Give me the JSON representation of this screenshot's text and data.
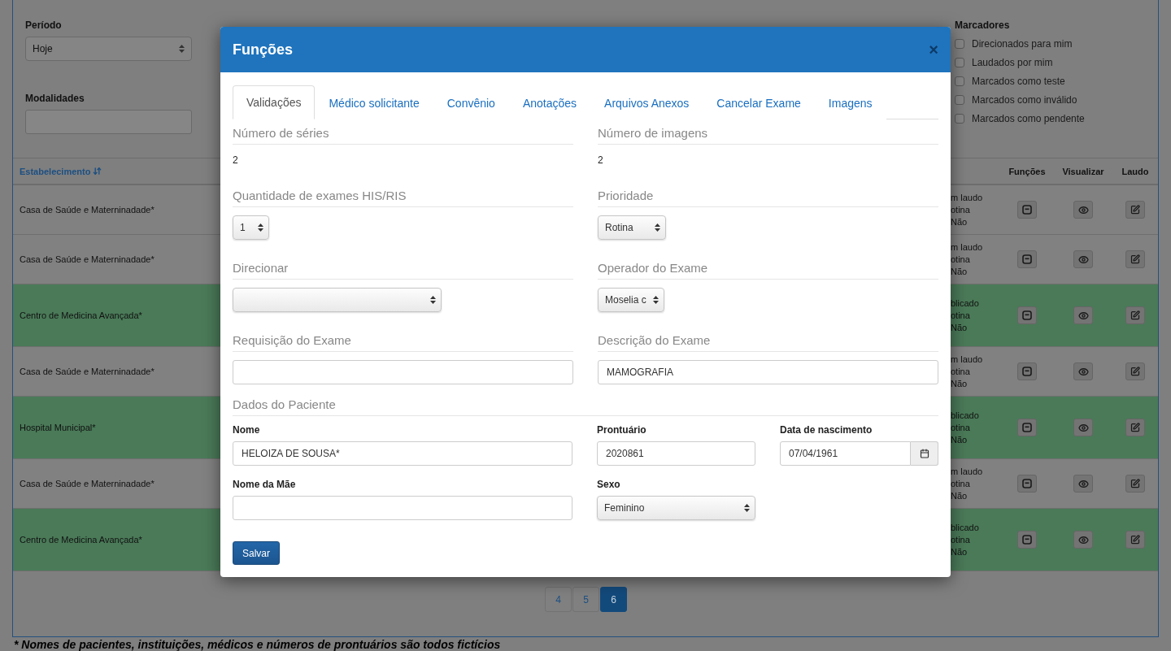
{
  "filters": {
    "row_1": [
      {
        "label": "Período",
        "kind": "select",
        "value": "Hoje"
      }
    ],
    "row_2": [
      {
        "label": "Modalidades",
        "kind": "input"
      }
    ]
  },
  "markers": {
    "title": "Marcadores",
    "items": [
      {
        "label": "Direcionados para mim",
        "checked": false
      },
      {
        "label": "Laudados por mim",
        "checked": false
      },
      {
        "label": "Marcados como teste",
        "checked": false
      },
      {
        "label": "Marcados como inválido",
        "checked": false
      },
      {
        "label": "Marcados como pendente",
        "checked": false
      }
    ]
  },
  "table": {
    "columns": [
      "Estabelecimento",
      "Funções",
      "Visualizar",
      "Laudo"
    ],
    "rows": [
      {
        "establishment": "Casa de Saúde e Materninadade*",
        "status": [
          "m laudo",
          "otina",
          "Não"
        ],
        "highlighted": false
      },
      {
        "establishment": "Casa de Saúde e Materninadade*",
        "status": [
          "m laudo",
          "otina",
          "Não"
        ],
        "highlighted": false
      },
      {
        "establishment": "Centro de Medicina Avançada*",
        "status": [
          "blicado",
          "otina",
          "Não"
        ],
        "highlighted": true
      },
      {
        "establishment": "Casa de Saúde e Materninadade*",
        "status": [
          "m laudo",
          "otina",
          "Não"
        ],
        "highlighted": false
      },
      {
        "establishment": "Hospital Municipal*",
        "status": [
          "blicado",
          "otina",
          "Não"
        ],
        "highlighted": true
      },
      {
        "establishment": "Casa de Saúde e Materninadade*",
        "status": [
          "m laudo",
          "otina",
          "Não"
        ],
        "highlighted": false
      },
      {
        "establishment": "Centro de Medicina Avançada*",
        "status": [
          "blicado",
          "otina",
          "Não"
        ],
        "highlighted": true
      }
    ]
  },
  "pagination": {
    "pages": [
      {
        "label": "4",
        "selected": false
      },
      {
        "label": "5",
        "selected": false
      },
      {
        "label": "6",
        "selected": true
      }
    ]
  },
  "footnote": "* Nomes de pacientes, instituições, médicos e números de prontuários são todos fictícios",
  "modal": {
    "title": "Funções",
    "close": "×",
    "tabs": [
      {
        "label": "Validações",
        "selected": true
      },
      {
        "label": "Médico solicitante",
        "selected": false
      },
      {
        "label": "Convênio",
        "selected": false
      },
      {
        "label": "Anotações",
        "selected": false
      },
      {
        "label": "Arquivos Anexos",
        "selected": false
      },
      {
        "label": "Cancelar Exame",
        "selected": false
      },
      {
        "label": "Imagens",
        "selected": false
      }
    ],
    "sections": [
      {
        "label": "Número de séries",
        "kind": "text",
        "value": "2"
      },
      {
        "label": "Número de imagens",
        "kind": "text",
        "value": "2"
      },
      {
        "label": "Quantidade de exames HIS/RIS",
        "kind": "select",
        "value": "1"
      },
      {
        "label": "Prioridade",
        "kind": "select",
        "value": "Rotina"
      },
      {
        "label": "Direcionar",
        "kind": "select"
      },
      {
        "label": "Operador do Exame",
        "kind": "select",
        "value": "Moselia c"
      },
      {
        "label": "Requisição do Exame",
        "kind": "input"
      },
      {
        "label": "Descrição do Exame",
        "kind": "input",
        "value": "MAMOGRAFIA"
      }
    ],
    "patient": {
      "title": "Dados do Paciente",
      "fields": [
        {
          "label": "Nome",
          "kind": "input",
          "value": "HELOIZA DE SOUSA*"
        },
        {
          "label": "Prontuário",
          "kind": "input",
          "value": "2020861"
        },
        {
          "label": "Data de nascimento",
          "kind": "date",
          "value": "07/04/1961"
        },
        {
          "label": "Nome da Mãe",
          "kind": "input"
        },
        {
          "label": "Sexo",
          "kind": "select",
          "value": "Feminino"
        }
      ]
    },
    "save_button": "Salvar"
  }
}
